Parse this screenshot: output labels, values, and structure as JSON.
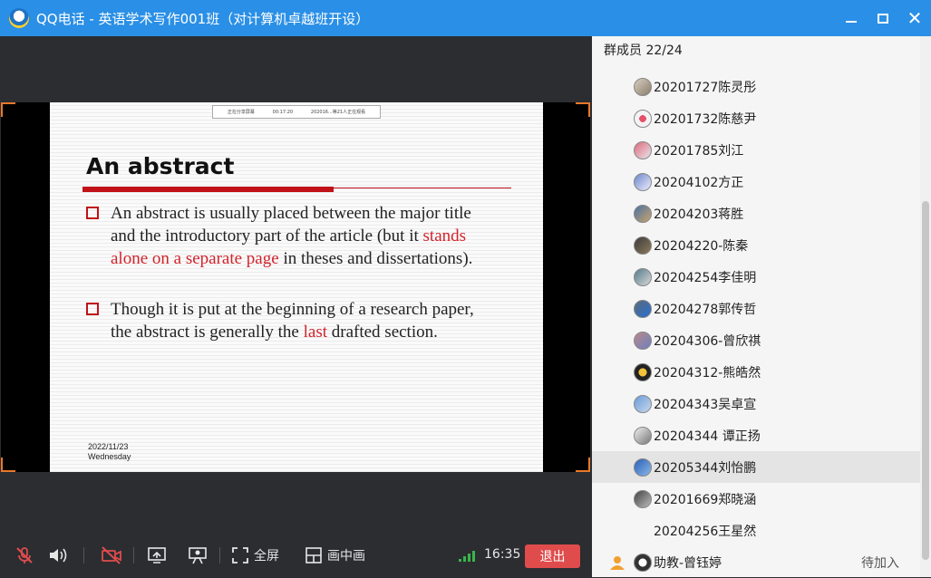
{
  "window": {
    "title": "QQ电话 - 英语学术写作001班（对计算机卓越班开设）",
    "accent_color": "#2a8fe6"
  },
  "slide": {
    "share_banner": [
      "正在分享屏幕",
      "00:17:20",
      "202016...等21人正在观看"
    ],
    "title": "An abstract",
    "bullet1": {
      "part1": "An abstract is usually placed between the major title and the introductory part of the article (but it ",
      "highlight": "stands alone on a separate page",
      "part2": " in theses and dissertations)."
    },
    "bullet2": {
      "part1": "Though it is put at the beginning of a research paper, the abstract is generally the ",
      "highlight": "last",
      "part2": " drafted section."
    },
    "date": "2022/11/23",
    "weekday": "Wednesday"
  },
  "toolbar": {
    "fullscreen_label": "全屏",
    "pip_label": "画中画",
    "time": "16:35",
    "exit_label": "退出",
    "icons": [
      "mic-muted-icon",
      "speaker-icon",
      "camera-off-icon",
      "screen-share-icon",
      "presenter-icon",
      "fullscreen-icon",
      "pip-icon",
      "signal-icon"
    ]
  },
  "members": {
    "header": "群成员 22/24",
    "list": [
      {
        "name": "20201727陈灵彤"
      },
      {
        "name": "20201732陈慈尹"
      },
      {
        "name": "20201785刘江"
      },
      {
        "name": "20204102方正"
      },
      {
        "name": "20204203蒋胜"
      },
      {
        "name": "20204220-陈秦"
      },
      {
        "name": "20204254李佳明"
      },
      {
        "name": "20204278郭传哲"
      },
      {
        "name": "20204306-曾欣祺"
      },
      {
        "name": "20204312-熊皓然"
      },
      {
        "name": "20204343吴卓宣"
      },
      {
        "name": "20204344 谭正扬"
      },
      {
        "name": "20205344刘怡鹏"
      },
      {
        "name": "20201669郑晓涵"
      },
      {
        "name": "20204256王星然"
      },
      {
        "name": "助教-曾钰婷",
        "status": "待加入"
      }
    ]
  }
}
